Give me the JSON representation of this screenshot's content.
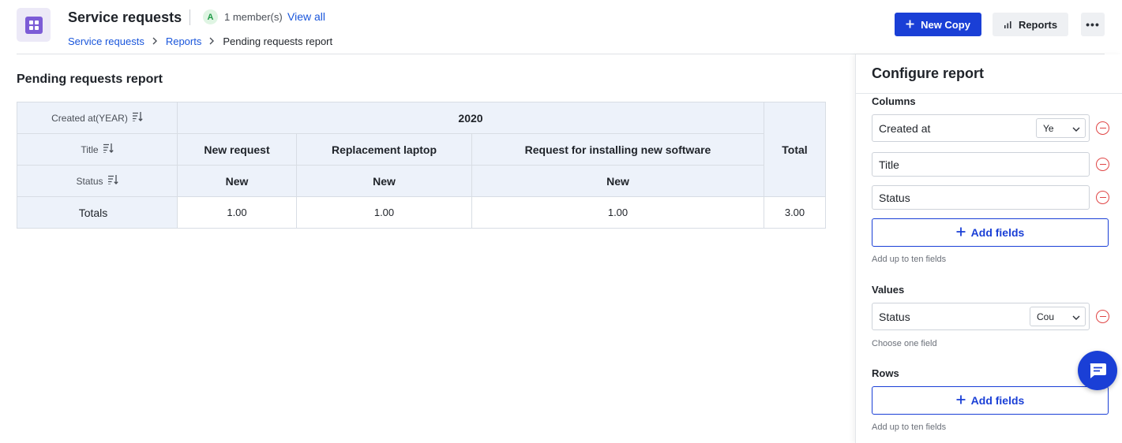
{
  "header": {
    "app_title": "Service requests",
    "member_avatar": "A",
    "member_count": "1 member(s)",
    "view_all": "View all",
    "new_copy_label": "New Copy",
    "reports_label": "Reports",
    "more_label": "•••"
  },
  "breadcrumb": {
    "items": [
      "Service requests",
      "Reports",
      "Pending requests report"
    ]
  },
  "report": {
    "title": "Pending requests report",
    "row_headers": [
      "Created at(YEAR)",
      "Title",
      "Status"
    ],
    "year": "2020",
    "titles": [
      "New request",
      "Replacement laptop",
      "Request for installing new software"
    ],
    "statuses": [
      "New",
      "New",
      "New"
    ],
    "total_header": "Total",
    "totals_label": "Totals",
    "totals": [
      "1.00",
      "1.00",
      "1.00"
    ],
    "grand_total": "3.00"
  },
  "panel": {
    "title": "Configure report",
    "columns_label": "Columns",
    "columns": [
      {
        "label": "Created at",
        "select": "Ye"
      },
      {
        "label": "Title"
      },
      {
        "label": "Status"
      }
    ],
    "add_fields_label": "Add fields",
    "columns_hint": "Add up to ten fields",
    "values_label": "Values",
    "values": [
      {
        "label": "Status",
        "select": "Cou"
      }
    ],
    "values_hint": "Choose one field",
    "rows_label": "Rows",
    "rows_add_label": "Add fields",
    "rows_hint": "Add up to ten fields"
  },
  "colors": {
    "primary": "#1a3fd6",
    "link": "#1a56db",
    "header_bg": "#edf2fa",
    "danger": "#e04646",
    "app_icon": "#7c5cd6"
  },
  "icons": [
    "app-grid-icon",
    "chevron-right-icon",
    "plus-icon",
    "bar-chart-icon",
    "more-icon",
    "sort-icon",
    "chevron-down-icon",
    "remove-icon",
    "chat-icon"
  ]
}
